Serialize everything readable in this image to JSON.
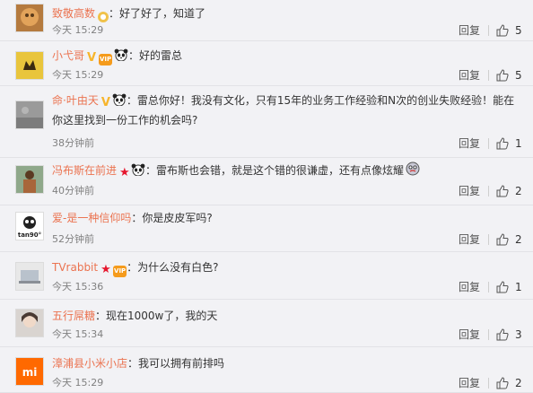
{
  "reply_label": "回复",
  "comments": [
    {
      "name": "致敬高数",
      "badges": [
        "medal"
      ],
      "text": "：好了好了，知道了",
      "time": "今天 15:29",
      "likes": "5",
      "avatar": "orange"
    },
    {
      "name": "小弋哥",
      "badges": [
        "v",
        "vip"
      ],
      "emoji": "panda",
      "text": "：好的雷总",
      "time": "今天 15:29",
      "likes": "5",
      "avatar": "lion"
    },
    {
      "name": "命·叶由天",
      "badges": [
        "v"
      ],
      "emoji": "panda",
      "text": "：雷总你好！我没有文化，只有15年的业务工作经验和N次的创业失败经验！能在你这里找到一份工作的机会吗?",
      "time": "38分钟前",
      "likes": "1",
      "avatar": "gray"
    },
    {
      "name": "冯布斯在前进",
      "badges": [
        "star"
      ],
      "emoji": "panda",
      "text": "：雷布斯也会错，就是这个错的很谦虚，还有点像炫耀",
      "emoji_after": "dizzy",
      "time": "40分钟前",
      "likes": "2",
      "avatar": "man"
    },
    {
      "name": "爱-是一种信仰吗",
      "badges": [],
      "text": "：你是皮皮军吗?",
      "time": "52分钟前",
      "likes": "2",
      "avatar": "tan90",
      "avatar_text": "tan90°"
    },
    {
      "name": "TVrabbit",
      "badges": [
        "star",
        "vip"
      ],
      "text": "：为什么没有白色?",
      "time": "今天 15:36",
      "likes": "1",
      "avatar": "laptop"
    },
    {
      "name": "五行屌糖",
      "badges": [],
      "text": "：现在1000w了，我的天",
      "time": "今天 15:34",
      "likes": "3",
      "avatar": "girl"
    },
    {
      "name": "漳浦县小米小店",
      "badges": [],
      "text": "：我可以拥有前排吗",
      "time": "今天 15:29",
      "likes": "2",
      "avatar": "mi"
    }
  ]
}
